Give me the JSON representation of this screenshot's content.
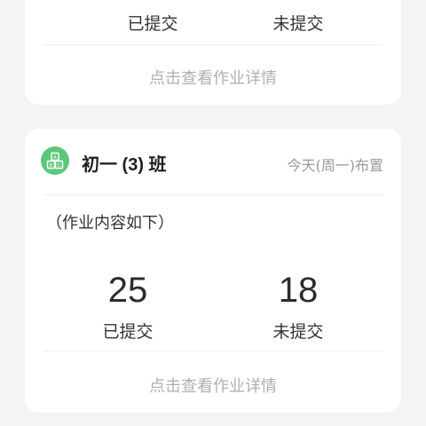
{
  "top_card": {
    "submitted_label": "已提交",
    "not_submitted_label": "未提交",
    "details_link": "点击查看作业详情"
  },
  "class_card": {
    "icon": "blocks-abc-icon",
    "class_name": "初一 (3) 班",
    "assigned_time": "今天(周一)布置",
    "homework_content": "（作业内容如下）",
    "submitted_count": "25",
    "submitted_label": "已提交",
    "not_submitted_count": "18",
    "not_submitted_label": "未提交",
    "details_link": "点击查看作业详情"
  },
  "colors": {
    "page_bg": "#f3f4f6",
    "card_bg": "#ffffff",
    "icon_bg": "#5cc77a",
    "muted_text": "#b0b0b0"
  }
}
